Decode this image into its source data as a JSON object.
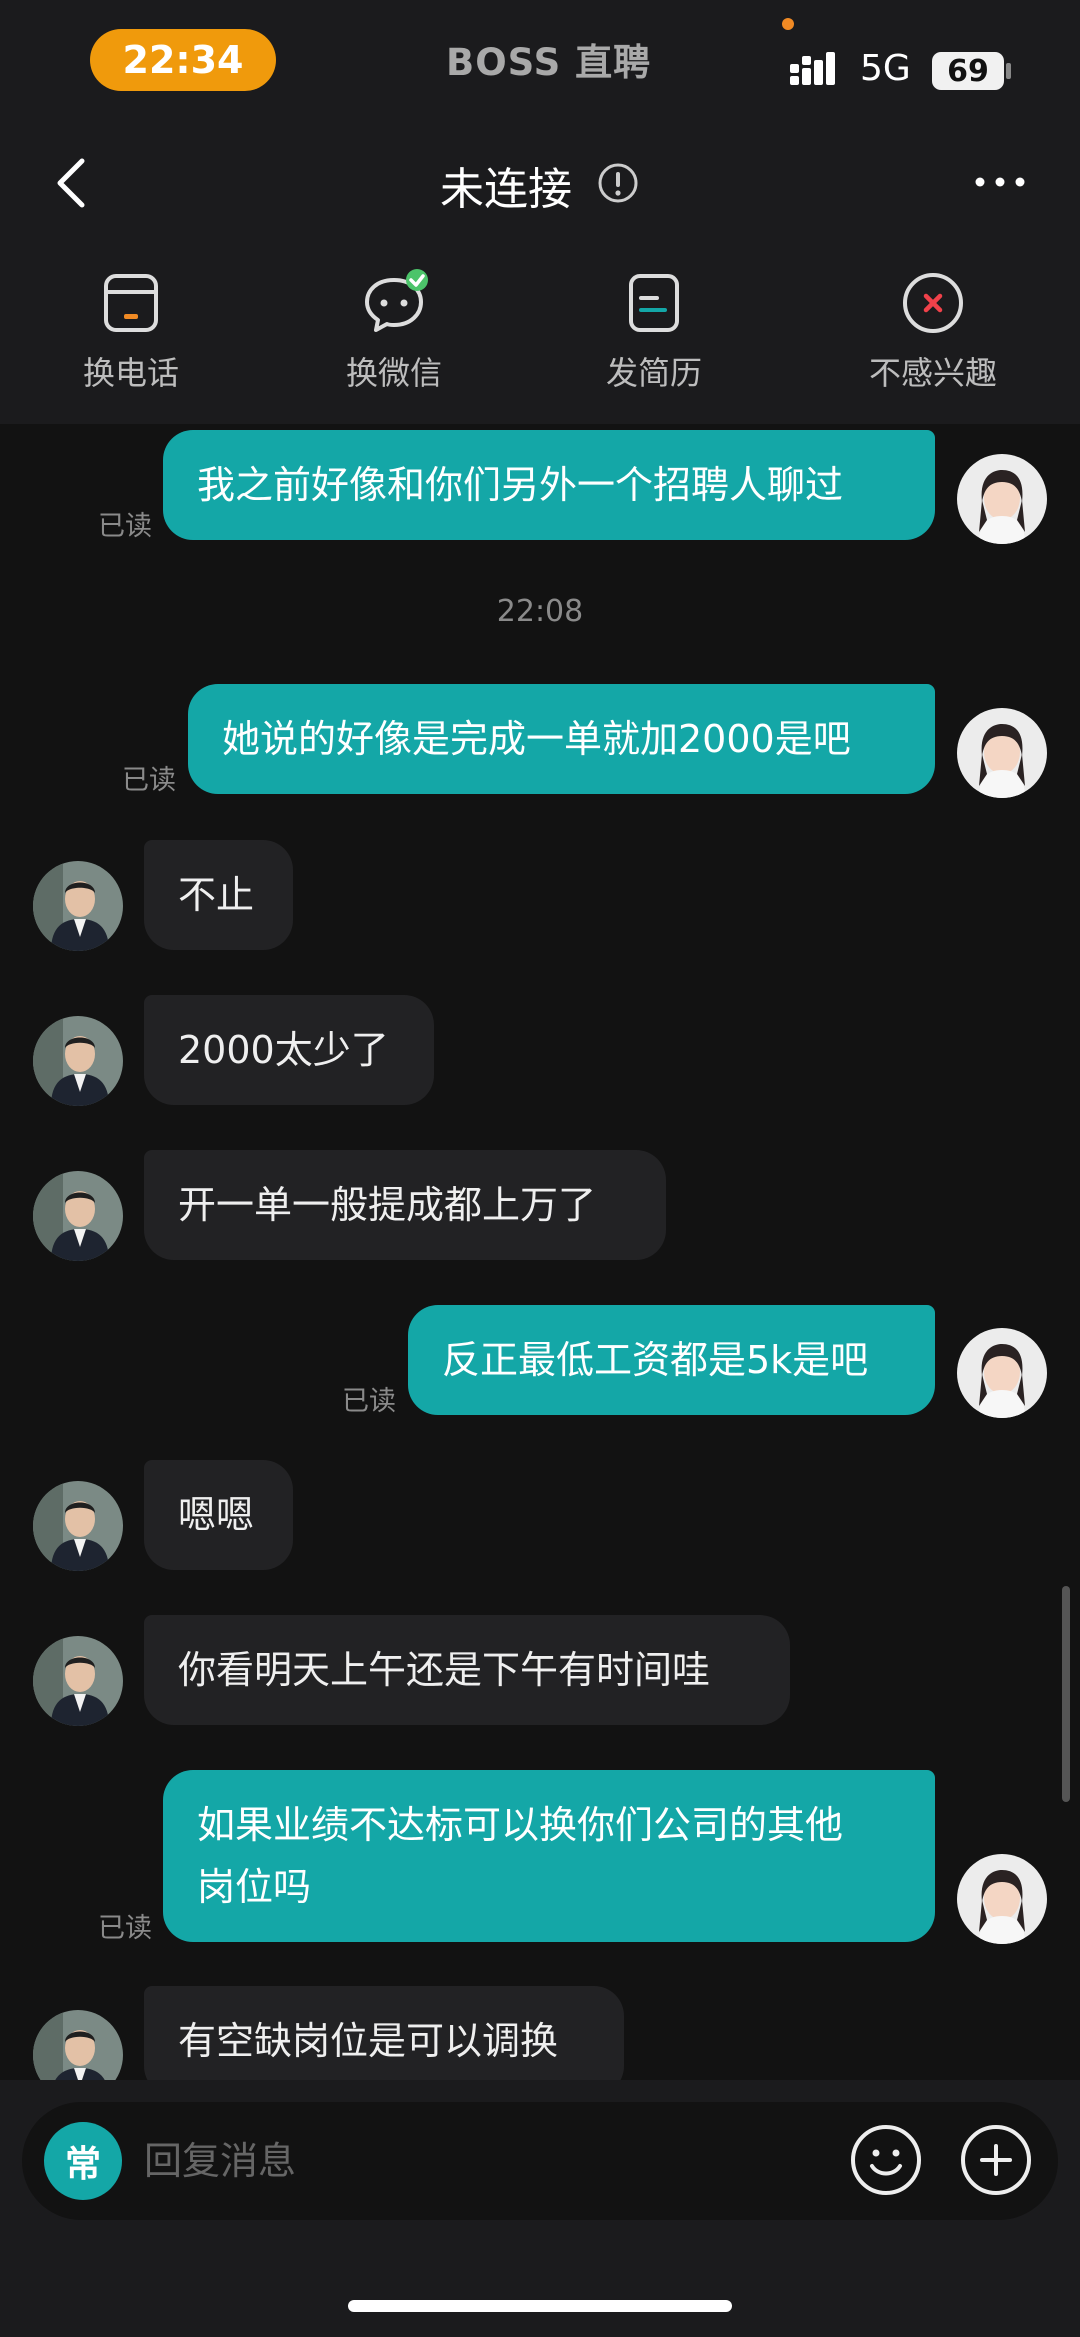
{
  "status_bar": {
    "time": "22:34",
    "app_name": "BOSS 直聘",
    "network": "5G",
    "battery": "69"
  },
  "header": {
    "title": "未连接",
    "back_icon": "chevron-left-icon",
    "info_icon": "info-circle-icon",
    "more_icon": "more-dots-icon"
  },
  "actions": [
    {
      "label": "换电话",
      "icon": "phone-card-icon"
    },
    {
      "label": "换微信",
      "icon": "wechat-chat-icon"
    },
    {
      "label": "发简历",
      "icon": "resume-icon"
    },
    {
      "label": "不感兴趣",
      "icon": "close-circle-icon"
    }
  ],
  "chat": {
    "read_label": "已读",
    "timestamp": "22:08",
    "messages": [
      {
        "dir": "out",
        "text": "我之前好像和你们另外一个招聘人聊过"
      },
      {
        "dir": "out",
        "text": "她说的好像是完成一单就加2000是吧"
      },
      {
        "dir": "in",
        "text": "不止"
      },
      {
        "dir": "in",
        "text": "2000太少了"
      },
      {
        "dir": "in",
        "text": "开一单一般提成都上万了"
      },
      {
        "dir": "out",
        "text": "反正最低工资都是5k是吧"
      },
      {
        "dir": "in",
        "text": "嗯嗯"
      },
      {
        "dir": "in",
        "text": "你看明天上午还是下午有时间哇"
      },
      {
        "dir": "out",
        "text_line1": "如果业绩不达标可以换你们公司的其他",
        "text_line2": "岗位吗"
      },
      {
        "dir": "in",
        "text": "有空缺岗位是可以调换"
      }
    ]
  },
  "input_bar": {
    "common_label": "常",
    "placeholder": "回复消息",
    "emoji_icon": "emoji-smile-icon",
    "plus_icon": "plus-circle-icon"
  },
  "colors": {
    "accent": "#14a7a7",
    "time_pill": "#f09a0c",
    "background": "#121212",
    "bar": "#1b1b1d",
    "incoming_bubble": "#222224"
  }
}
